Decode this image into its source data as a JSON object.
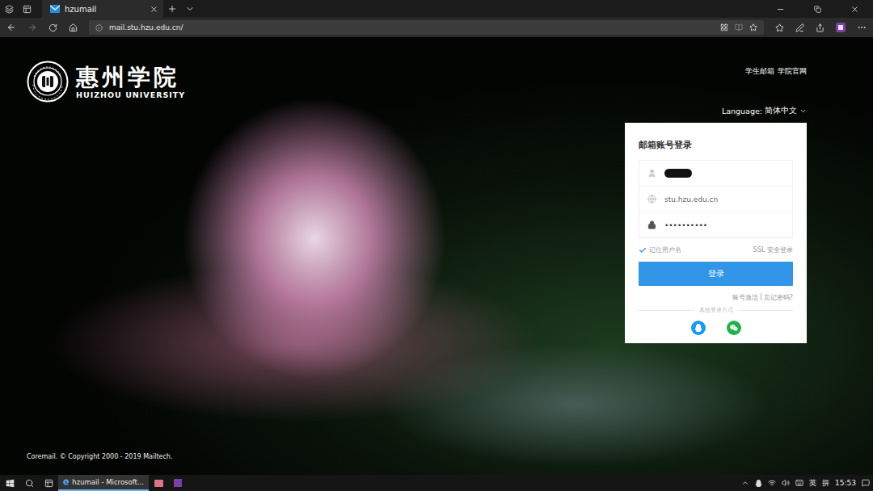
{
  "browser": {
    "tabs": [
      {
        "title": "hzumail",
        "selected": true
      }
    ],
    "address": "mail.stu.hzu.edu.cn/"
  },
  "page": {
    "logo": {
      "name_cn": "惠州学院",
      "name_en": "HUIZHOU UNIVERSITY"
    },
    "top_links": [
      "学生邮箱",
      "学院官网"
    ],
    "language": {
      "label": "Language:",
      "value": "简体中文"
    },
    "login": {
      "title": "邮箱账号登录",
      "username": {
        "redacted": true
      },
      "domain": "stu.hzu.edu.cn",
      "password": "••••••••••",
      "remember": {
        "label": "记住用户名",
        "checked": true
      },
      "ssl": "SSL 安全登录",
      "button": "登录",
      "links": [
        "账号激活",
        "忘记密码?"
      ],
      "link_separator": "|",
      "other_login": "其他登录方式"
    },
    "footer": "Coremail. © Copyright 2000 - 2019 Mailtech."
  },
  "taskbar": {
    "apps": [
      {
        "label": "hzumail - Microsoft...",
        "selected": true
      }
    ],
    "ime": [
      "英",
      "拼"
    ],
    "time": "15:53"
  }
}
